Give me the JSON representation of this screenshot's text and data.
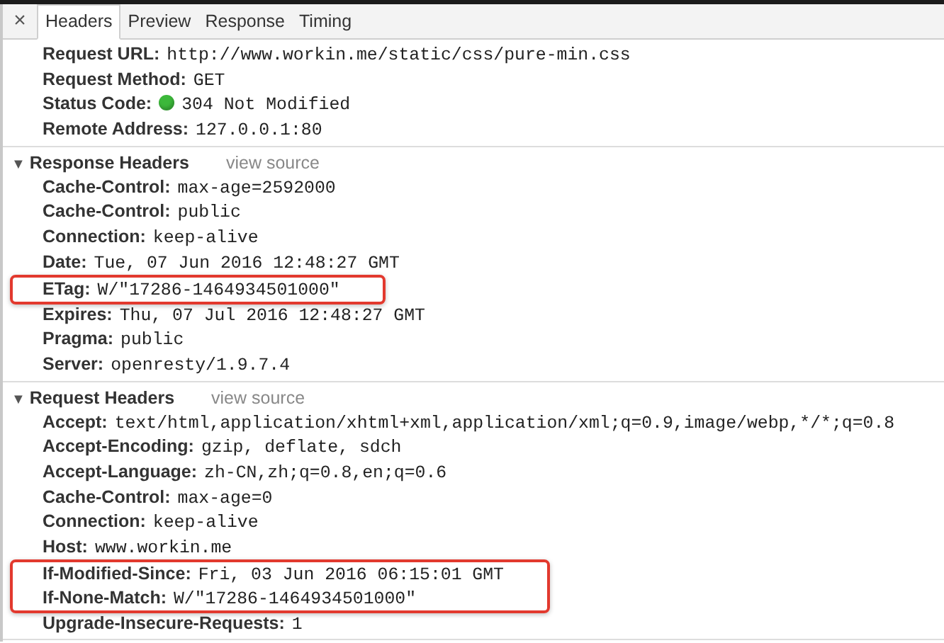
{
  "tabs": {
    "close": "×",
    "items": [
      {
        "label": "Headers",
        "selected": true
      },
      {
        "label": "Preview",
        "selected": false
      },
      {
        "label": "Response",
        "selected": false
      },
      {
        "label": "Timing",
        "selected": false
      }
    ]
  },
  "sections": [
    {
      "kind": "general",
      "rows": [
        {
          "name": "Request URL:",
          "value": "http://www.workin.me/static/css/pure-min.css",
          "highlighted": false
        },
        {
          "name": "Request Method:",
          "value": "GET",
          "highlighted": false
        },
        {
          "name": "Status Code:",
          "value": "304 Not Modified",
          "color": "#3cb83a",
          "highlighted": false
        },
        {
          "name": "Remote Address:",
          "value": "127.0.0.1:80",
          "highlighted": false
        }
      ]
    },
    {
      "kind": "group",
      "toggle": "▼",
      "title": "Response Headers",
      "view_source": "view source",
      "expanded": true,
      "rows": [
        {
          "name": "Cache-Control:",
          "value": "max-age=2592000",
          "highlighted": false
        },
        {
          "name": "Cache-Control:",
          "value": "public",
          "highlighted": false
        },
        {
          "name": "Connection:",
          "value": "keep-alive",
          "highlighted": false
        },
        {
          "name": "Date:",
          "value": "Tue, 07 Jun 2016 12:48:27 GMT",
          "highlighted": false
        },
        {
          "name": "ETag:",
          "value": "W/\"17286-1464934501000\"",
          "highlighted": true
        },
        {
          "name": "Expires:",
          "value": "Thu, 07 Jul 2016 12:48:27 GMT",
          "highlighted": false
        },
        {
          "name": "Pragma:",
          "value": "public",
          "highlighted": false
        },
        {
          "name": "Server:",
          "value": "openresty/1.9.7.4",
          "highlighted": false
        }
      ]
    },
    {
      "kind": "group",
      "toggle": "▼",
      "title": "Request Headers",
      "view_source": "view source",
      "expanded": true,
      "rows": [
        {
          "name": "Accept:",
          "value": "text/html,application/xhtml+xml,application/xml;q=0.9,image/webp,*/*;q=0.8",
          "highlighted": false
        },
        {
          "name": "Accept-Encoding:",
          "value": "gzip, deflate, sdch",
          "highlighted": false
        },
        {
          "name": "Accept-Language:",
          "value": "zh-CN,zh;q=0.8,en;q=0.6",
          "highlighted": false
        },
        {
          "name": "Cache-Control:",
          "value": "max-age=0",
          "highlighted": false
        },
        {
          "name": "Connection:",
          "value": "keep-alive",
          "highlighted": false
        },
        {
          "name": "Host:",
          "value": "www.workin.me",
          "highlighted": false
        },
        {
          "name": "If-Modified-Since:",
          "value": "Fri, 03 Jun 2016 06:15:01 GMT",
          "highlighted": true
        },
        {
          "name": "If-None-Match:",
          "value": "W/\"17286-1464934501000\"",
          "highlighted": true
        },
        {
          "name": "Upgrade-Insecure-Requests:",
          "value": "1",
          "highlighted": false
        }
      ]
    }
  ]
}
